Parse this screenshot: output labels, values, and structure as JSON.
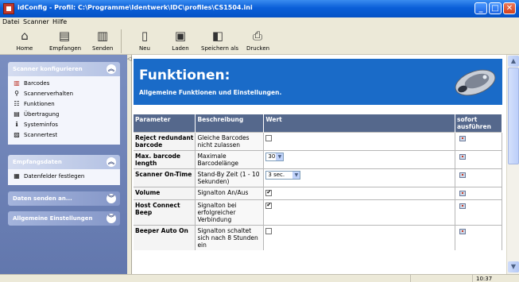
{
  "window": {
    "title": "idConfig - Profil: C:\\Programme\\Identwerk\\IDC\\profiles\\CS1504.ini",
    "minimize": "_",
    "maximize": "□",
    "close": "✕"
  },
  "menubar": {
    "items": [
      "Datei",
      "Scanner",
      "Hilfe"
    ]
  },
  "toolbar": {
    "buttons": [
      {
        "label": "Home",
        "icon": "home-icon"
      },
      {
        "label": "Empfangen",
        "icon": "receive-icon"
      },
      {
        "label": "Senden",
        "icon": "send-icon"
      },
      {
        "label": "Neu",
        "icon": "new-document-icon"
      },
      {
        "label": "Laden",
        "icon": "load-icon"
      },
      {
        "label": "Speichern als",
        "icon": "save-as-icon"
      },
      {
        "label": "Drucken",
        "icon": "print-icon"
      }
    ]
  },
  "sidebar": {
    "panels": [
      {
        "title": "Scanner konfigurieren",
        "items": [
          {
            "label": "Barcodes",
            "icon": "barcode-icon"
          },
          {
            "label": "Scannerverhalten",
            "icon": "scanner-icon"
          },
          {
            "label": "Funktionen",
            "icon": "functions-icon"
          },
          {
            "label": "Übertragung",
            "icon": "transfer-icon"
          },
          {
            "label": "Systeminfos",
            "icon": "system-info-icon"
          },
          {
            "label": "Scannertest",
            "icon": "scanner-test-icon"
          }
        ]
      },
      {
        "title": "Empfangsdaten",
        "items": [
          {
            "label": "Datenfelder festlegen",
            "icon": "data-fields-icon"
          }
        ]
      },
      {
        "title": "Daten senden an...",
        "items": []
      },
      {
        "title": "Allgemeine Einstellungen",
        "items": []
      }
    ]
  },
  "content": {
    "title": "Funktionen:",
    "subtitle": "Allgemeine Funktionen und Einstellungen.",
    "table": {
      "headers": [
        "Parameter",
        "Beschreibung",
        "Wert",
        "sofort ausführen"
      ],
      "rows": [
        {
          "param": "Reject redundant barcode",
          "desc": "Gleiche Barcodes nicht zulassen",
          "type": "checkbox",
          "checked": false
        },
        {
          "param": "Max. barcode length",
          "desc": "Maximale Barcodelänge",
          "type": "select",
          "value": "30"
        },
        {
          "param": "Scanner On-Time",
          "desc": "Stand-By Zeit (1 - 10 Sekunden)",
          "type": "select",
          "value": "3 sec."
        },
        {
          "param": "Volume",
          "desc": "Signalton An/Aus",
          "type": "checkbox",
          "checked": true
        },
        {
          "param": "Host Connect Beep",
          "desc": "Signalton bei erfolgreicher Verbindung",
          "type": "checkbox",
          "checked": true
        },
        {
          "param": "Beeper Auto On",
          "desc": "Signalton schaltet sich nach 8 Stunden ein",
          "type": "checkbox",
          "checked": false
        }
      ]
    }
  },
  "statusbar": {
    "time": "10:37"
  },
  "colors": {
    "banner": "#1a6bc8",
    "table_header": "#55688c",
    "sidebar": "#6f84ba"
  }
}
